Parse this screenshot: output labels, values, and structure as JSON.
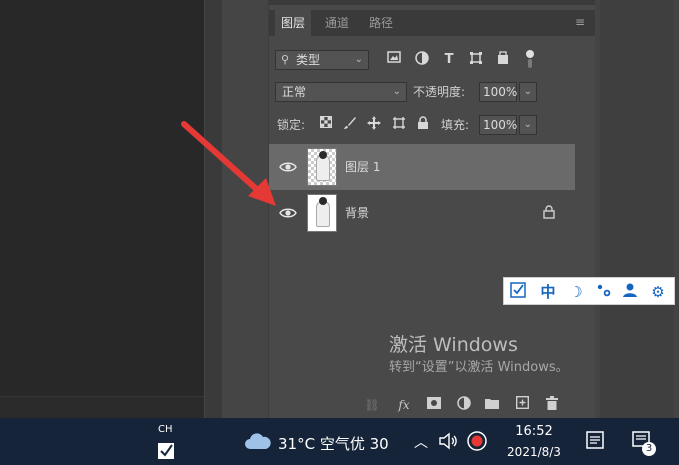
{
  "layers_panel": {
    "tabs": [
      {
        "label": "图层",
        "active": true
      },
      {
        "label": "通道",
        "active": false
      },
      {
        "label": "路径",
        "active": false
      }
    ],
    "filter": {
      "value": "类型"
    },
    "blend_mode": {
      "value": "正常"
    },
    "opacity": {
      "label": "不透明度:",
      "value": "100%"
    },
    "lock": {
      "label": "锁定:"
    },
    "fill": {
      "label": "填充:",
      "value": "100%"
    },
    "layers": [
      {
        "name": "图层 1",
        "selected": true,
        "visible": true,
        "locked": false
      },
      {
        "name": "背景",
        "selected": false,
        "visible": true,
        "locked": true
      }
    ],
    "bottom_icons": [
      "link-icon",
      "fx-icon",
      "mask-icon",
      "adjustment-icon",
      "folder-icon",
      "new-layer-icon",
      "trash-icon"
    ],
    "bottom_fx_label": "fx"
  },
  "ime_toolbar": {
    "mode_label": "中"
  },
  "watermark": {
    "line1": "激活 Windows",
    "line2": "转到“设置”以激活 Windows。"
  },
  "taskbar": {
    "input_lang": "CH",
    "weather": "31°C 空气优 30",
    "time": "16:52",
    "date": "2021/8/3",
    "notification_count": "3"
  },
  "colors": {
    "panel_bg": "#494949",
    "selected_layer": "#6a6a6a",
    "taskbar_bg": "#16243a",
    "annotation_arrow": "#e53935",
    "ime_blue": "#1565c0"
  }
}
